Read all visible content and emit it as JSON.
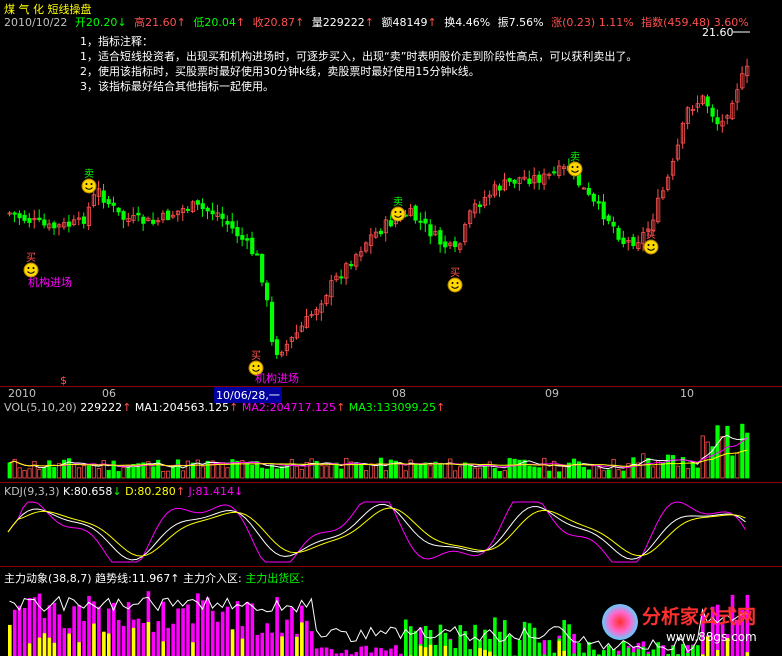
{
  "colors": {
    "up": "#ff5050",
    "down": "#00ff00",
    "bg": "#000000",
    "white": "#ffffff",
    "yellow": "#ffff00",
    "magenta": "#ff00ff",
    "cyan": "#00ffff",
    "grid": "#8b0000"
  },
  "header": {
    "title": "煤 气 化 短线操盘",
    "date": "2010/10/22",
    "open_label": "开",
    "open": "20.20",
    "high_label": "高",
    "high": "21.60",
    "low_label": "低",
    "low": "20.04",
    "close_label": "收",
    "close": "20.87",
    "vol_label": "量",
    "vol": "229222",
    "amt_label": "额",
    "amt": "48149",
    "turnover_label": "换",
    "turnover": "4.46%",
    "amp_label": "振",
    "amp": "7.56%",
    "chg_label": "涨",
    "chg": "(0.23) 1.11%",
    "index_label": "指数",
    "index": "(459.48) 3.60%"
  },
  "notes": [
    "1，指标注释：",
    "1，适合短线投资者，出现买和机构进场时，可逐步买入，出现“卖”时表明股价走到阶段性高点，可以获利卖出了。",
    "2，使用该指标时，买股票时最好使用30分钟k线，卖股票时最好使用15分钟k线。",
    "3，该指标最好结合其他指标一起使用。"
  ],
  "price_chart": {
    "high_marker": "21.60",
    "signals": {
      "buy": "买",
      "sell": "卖",
      "institution": "机构进场",
      "dollar": "$"
    },
    "candles_seed": 20.0
  },
  "time_axis": {
    "labels": [
      "2010",
      "06",
      "10/06/28,一",
      "08",
      "09",
      "10"
    ]
  },
  "vol_panel": {
    "name": "VOL(5,10,20)",
    "value": "229222",
    "ma1": "MA1:204563.125",
    "ma2": "MA2:204717.125",
    "ma3": "MA3:133099.25",
    "arrow": "↑"
  },
  "kdj_panel": {
    "name": "KDJ(9,3,3)",
    "k": "K:80.658",
    "d": "D:80.280",
    "j": "J:81.414",
    "arrow_k": "↓",
    "arrow_d": "↑",
    "arrow_j": "↓"
  },
  "main_panel": {
    "name": "主力动象(38,8,7)",
    "trend": "趋势线:11.967",
    "inflow": "主力介入区:",
    "outflow": "主力出货区:",
    "arrow": "↑"
  },
  "watermark": {
    "text": "分析家公式网",
    "url": "www.88gs.com"
  }
}
